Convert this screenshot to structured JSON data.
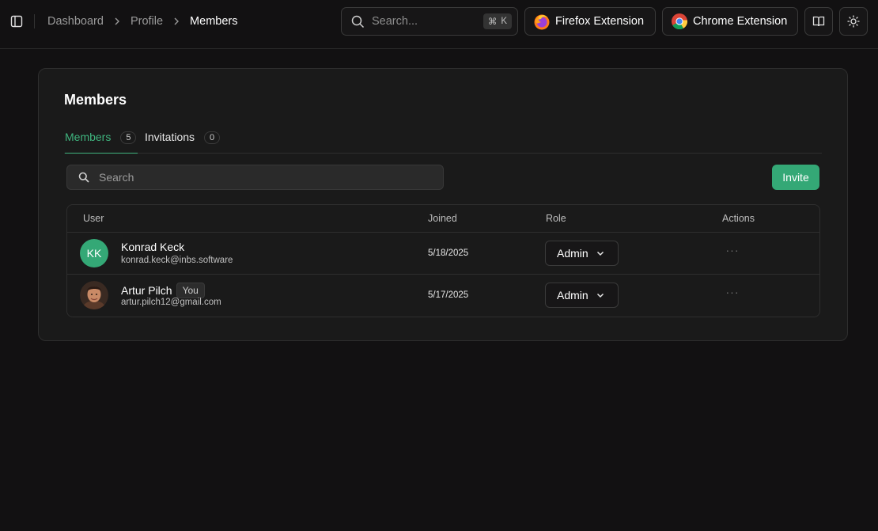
{
  "breadcrumb": [
    "Dashboard",
    "Profile",
    "Members"
  ],
  "search": {
    "placeholder": "Search...",
    "shortcut_symbol": "⌘",
    "shortcut_key": "K"
  },
  "extensions": {
    "firefox_label": "Firefox Extension",
    "chrome_label": "Chrome Extension"
  },
  "card": {
    "title": "Members",
    "tabs": [
      {
        "label": "Members",
        "count": "5",
        "active": true
      },
      {
        "label": "Invitations",
        "count": "0",
        "active": false
      }
    ],
    "search_placeholder": "Search",
    "invite_label": "Invite"
  },
  "table": {
    "headers": {
      "user": "User",
      "joined": "Joined",
      "role": "Role",
      "actions": "Actions"
    },
    "rows": [
      {
        "initials": "KK",
        "name": "Konrad Keck",
        "email": "konrad.keck@inbs.software",
        "joined": "5/18/2025",
        "role": "Admin",
        "actions": "···"
      },
      {
        "initials": "",
        "name": "Artur Pilch",
        "badge": "You",
        "email": "artur.pilch12@gmail.com",
        "joined": "5/17/2025",
        "role": "Admin",
        "actions": "···"
      }
    ]
  },
  "colors": {
    "accent": "#34a876",
    "tab_active": "#3fb47e",
    "background": "#121112",
    "card": "#1a1a1a"
  },
  "icons": [
    "sidebar-toggle-icon",
    "chevron-right-icon",
    "search-icon",
    "firefox-logo-icon",
    "chrome-logo-icon",
    "book-open-icon",
    "sun-icon",
    "chevron-down-icon",
    "ellipsis-icon"
  ]
}
